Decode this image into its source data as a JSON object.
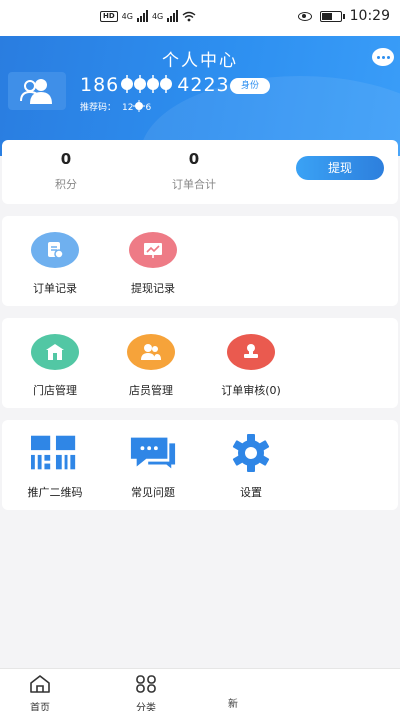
{
  "status_bar": {
    "left_badges": [
      "HD",
      "4G",
      "4G"
    ],
    "time": "10:29"
  },
  "header": {
    "title": "个人中心",
    "phone_prefix": "186",
    "phone_suffix": "4223",
    "id_badge": "身份",
    "referral_label": "推荐码：",
    "referral_value_visible": "12",
    "referral_value_visible_end": "6"
  },
  "stats": {
    "points_value": "0",
    "points_label": "积分",
    "orders_value": "0",
    "orders_label": "订单合计",
    "withdraw_label": "提现"
  },
  "section1": {
    "items": [
      {
        "label": "订单记录",
        "icon": "order-record-icon",
        "color": "#6fb0ef"
      },
      {
        "label": "提现记录",
        "icon": "withdraw-record-icon",
        "color": "#ee7b86"
      }
    ]
  },
  "section2": {
    "items": [
      {
        "label": "门店管理",
        "icon": "store-icon",
        "color": "#52c7a4"
      },
      {
        "label": "店员管理",
        "icon": "staff-icon",
        "color": "#f6a33a"
      },
      {
        "label": "订单审核(0)",
        "icon": "stamp-icon",
        "color": "#ea5a4f"
      }
    ]
  },
  "section3": {
    "items": [
      {
        "label": "推广二维码",
        "icon": "qr-code-icon",
        "color": "#2f86e6"
      },
      {
        "label": "常见问题",
        "icon": "faq-chat-icon",
        "color": "#2f86e6"
      },
      {
        "label": "设置",
        "icon": "gear-icon",
        "color": "#2f86e6"
      }
    ]
  },
  "bottom_nav": {
    "items": [
      {
        "label": "首页",
        "icon": "home-icon"
      },
      {
        "label": "分类",
        "icon": "category-icon"
      }
    ],
    "partial_label": "新"
  }
}
